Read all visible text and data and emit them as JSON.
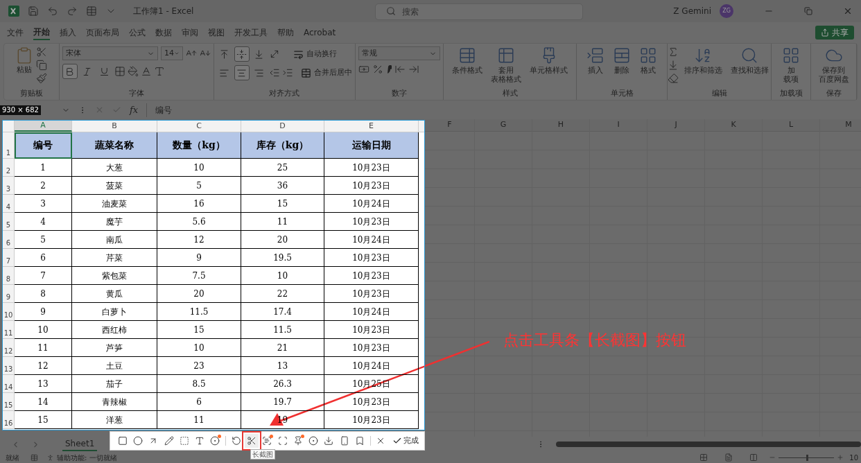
{
  "title_bar": {
    "document_title": "工作簿1 - Excel",
    "search_placeholder": "搜索",
    "user_name": "Z Gemini",
    "avatar_initials": "ZG"
  },
  "menu_tabs": [
    {
      "label": "文件",
      "selected": false
    },
    {
      "label": "开始",
      "selected": true
    },
    {
      "label": "插入",
      "selected": false
    },
    {
      "label": "页面布局",
      "selected": false
    },
    {
      "label": "公式",
      "selected": false
    },
    {
      "label": "数据",
      "selected": false
    },
    {
      "label": "审阅",
      "selected": false
    },
    {
      "label": "视图",
      "selected": false
    },
    {
      "label": "开发工具",
      "selected": false
    },
    {
      "label": "帮助",
      "selected": false
    },
    {
      "label": "Acrobat",
      "selected": false
    }
  ],
  "share_button": "共享",
  "ribbon": {
    "clipboard": {
      "label": "剪贴板",
      "paste": "粘贴"
    },
    "font": {
      "label": "字体",
      "font_name": "宋体",
      "font_size": "14",
      "format_buttons": [
        {
          "kind": "bold",
          "on": true
        },
        {
          "kind": "italic",
          "on": false
        },
        {
          "kind": "underline",
          "on": false
        }
      ]
    },
    "alignment": {
      "label": "对齐方式",
      "vertical": [
        {
          "kind": "top",
          "on": false
        },
        {
          "kind": "middle",
          "on": true
        },
        {
          "kind": "bottom",
          "on": false
        }
      ],
      "horizontal": [
        {
          "kind": "left",
          "on": false
        },
        {
          "kind": "center",
          "on": true
        },
        {
          "kind": "right",
          "on": false
        }
      ],
      "wrap": "自动换行",
      "merge": "合并后居中"
    },
    "number": {
      "label": "数字",
      "format": "常规"
    },
    "styles": {
      "label": "样式",
      "buttons": [
        {
          "kind": "conditional",
          "lines": [
            "条件格式"
          ]
        },
        {
          "kind": "table",
          "lines": [
            "套用",
            "表格格式"
          ]
        },
        {
          "kind": "cellstyle",
          "lines": [
            "单元格样式"
          ]
        }
      ]
    },
    "cells": {
      "label": "单元格",
      "buttons": [
        {
          "kind": "insert",
          "lines": [
            "插入"
          ]
        },
        {
          "kind": "delete",
          "lines": [
            "删除"
          ]
        },
        {
          "kind": "format",
          "lines": [
            "格式"
          ]
        }
      ]
    },
    "editing": {
      "label": "编辑",
      "buttons": [
        {
          "kind": "sort",
          "lines": [
            "排序和筛选"
          ]
        },
        {
          "kind": "find",
          "lines": [
            "查找和选择"
          ]
        }
      ]
    },
    "addins": {
      "label": "加载项",
      "buttons": [
        {
          "kind": "addin",
          "lines": [
            "加",
            "载项"
          ]
        }
      ]
    },
    "save": {
      "label": "保存",
      "buttons": [
        {
          "kind": "cloud",
          "lines": [
            "保存到",
            "百度网盘"
          ]
        }
      ]
    }
  },
  "formula_bar": {
    "capture_size": "930 × 682",
    "function_label": "fx",
    "formula": "编号"
  },
  "columns": [
    {
      "label": "A",
      "selected": true
    },
    {
      "label": "B",
      "selected": false
    },
    {
      "label": "C",
      "selected": false
    },
    {
      "label": "D",
      "selected": false
    },
    {
      "label": "E",
      "selected": false
    },
    {
      "label": "F",
      "selected": false
    },
    {
      "label": "G",
      "selected": false
    },
    {
      "label": "H",
      "selected": false
    },
    {
      "label": "I",
      "selected": false
    },
    {
      "label": "J",
      "selected": false
    },
    {
      "label": "K",
      "selected": false
    },
    {
      "label": "L",
      "selected": false
    },
    {
      "label": "M",
      "selected": false
    }
  ],
  "row_numbers": [
    "1",
    "2",
    "3",
    "4",
    "5",
    "6",
    "7",
    "8",
    "9",
    "10",
    "11",
    "12",
    "13",
    "14",
    "15",
    "16"
  ],
  "table": {
    "header": [
      "编号",
      "蔬菜名称",
      "数量（kg）",
      "库存（kg）",
      "运输日期"
    ],
    "rows": [
      [
        "1",
        "大葱",
        "10",
        "25",
        "10月23日"
      ],
      [
        "2",
        "菠菜",
        "5",
        "36",
        "10月23日"
      ],
      [
        "3",
        "油麦菜",
        "16",
        "15",
        "10月24日"
      ],
      [
        "4",
        "魔芋",
        "5.6",
        "11",
        "10月23日"
      ],
      [
        "5",
        "南瓜",
        "12",
        "20",
        "10月24日"
      ],
      [
        "6",
        "芹菜",
        "9",
        "19.5",
        "10月23日"
      ],
      [
        "7",
        "紫包菜",
        "7.5",
        "10",
        "10月23日"
      ],
      [
        "8",
        "黄瓜",
        "20",
        "22",
        "10月23日"
      ],
      [
        "9",
        "白萝卜",
        "11.5",
        "17.4",
        "10月24日"
      ],
      [
        "10",
        "西红柿",
        "15",
        "11.5",
        "10月23日"
      ],
      [
        "11",
        "芦笋",
        "10",
        "21",
        "10月23日"
      ],
      [
        "12",
        "土豆",
        "23",
        "13",
        "10月24日"
      ],
      [
        "13",
        "茄子",
        "8.5",
        "26.3",
        "10月25日"
      ],
      [
        "14",
        "青辣椒",
        "6",
        "19.7",
        "10月23日"
      ],
      [
        "15",
        "洋葱",
        "11",
        "19",
        "10月23日"
      ]
    ]
  },
  "capture_toolbar": {
    "tools": [
      {
        "kind": "rectangle",
        "dot": false,
        "selected": false
      },
      {
        "kind": "ellipse",
        "dot": false,
        "selected": false
      },
      {
        "kind": "arrow",
        "dot": false,
        "selected": false
      },
      {
        "kind": "pencil",
        "dot": false,
        "selected": false
      },
      {
        "kind": "mosaic",
        "dot": false,
        "selected": false
      },
      {
        "kind": "text",
        "dot": false,
        "selected": false
      },
      {
        "kind": "number",
        "dot": true,
        "selected": false
      },
      {
        "kind": "divider"
      },
      {
        "kind": "undo",
        "dot": false,
        "selected": false
      },
      {
        "kind": "long",
        "dot": false,
        "selected": true
      },
      {
        "kind": "ocr",
        "dot": true,
        "selected": false
      },
      {
        "kind": "scan",
        "dot": false,
        "selected": false
      },
      {
        "kind": "pin",
        "dot": true,
        "selected": false
      },
      {
        "kind": "record",
        "dot": false,
        "selected": false
      },
      {
        "kind": "download",
        "dot": false,
        "selected": false
      },
      {
        "kind": "phone",
        "dot": false,
        "selected": false
      },
      {
        "kind": "bookmark",
        "dot": false,
        "selected": false
      },
      {
        "kind": "divider"
      },
      {
        "kind": "close",
        "dot": false,
        "selected": false
      }
    ],
    "done": "完成",
    "tooltip": "长截图"
  },
  "annotation": "点击工具条【长截图】按钮",
  "sheet_tabs": [
    {
      "label": "Sheet1",
      "selected": true
    }
  ],
  "status_bar": {
    "ready": "就绪",
    "accessibility": "辅助功能: 一切就绪",
    "zoom_slider": {
      "level": 0.5
    },
    "zoom_text": "10"
  }
}
